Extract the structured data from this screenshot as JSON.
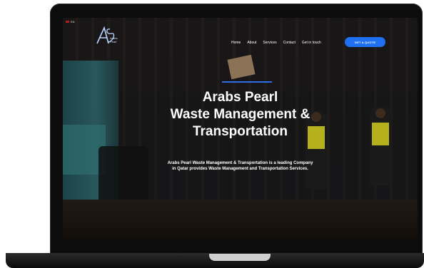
{
  "nav": {
    "language": "EN",
    "logo": {
      "line1": "Arabs",
      "line2": "Pearl"
    },
    "links": [
      "Home",
      "About",
      "Services",
      "Contact",
      "Get in touch"
    ],
    "cta": "GET A QUOTE"
  },
  "hero": {
    "title_lines": [
      "Arabs Pearl",
      "Waste Management &",
      "Transportation"
    ],
    "description_lines": [
      "Arabs Pearl Waste Management & Transportation is a leading Company",
      "in Qatar provides Waste Management and Transportation Services."
    ]
  },
  "colors": {
    "accent": "#1f6ff2",
    "laptop_frame": "#0c0c0c"
  }
}
